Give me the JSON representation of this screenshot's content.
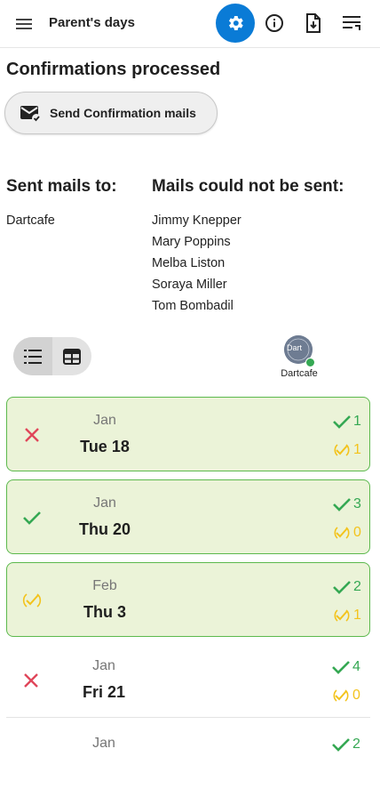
{
  "header": {
    "title": "Parent's days"
  },
  "main": {
    "section_title": "Confirmations processed",
    "send_button_label": "Send Confirmation mails",
    "sent_title": "Sent mails to:",
    "sent_list": [
      "Dartcafe"
    ],
    "failed_title": "Mails could not be sent:",
    "failed_list": [
      "Jimmy Knepper",
      "Mary Poppins",
      "Melba Liston",
      "Soraya Miller",
      "Tom Bombadil"
    ],
    "avatar_name": "Dartcafe",
    "avatar_initials": "Dart"
  },
  "dates": [
    {
      "month": "Jan",
      "date": "Tue 18",
      "status": "no",
      "yes": "1",
      "maybe": "1"
    },
    {
      "month": "Jan",
      "date": "Thu 20",
      "status": "yes",
      "yes": "3",
      "maybe": "0"
    },
    {
      "month": "Feb",
      "date": "Thu 3",
      "status": "maybe",
      "yes": "2",
      "maybe": "1"
    },
    {
      "month": "Jan",
      "date": "Fri 21",
      "status": "no",
      "yes": "4",
      "maybe": "0"
    },
    {
      "month": "Jan",
      "date": "",
      "status": "",
      "yes": "2",
      "maybe": ""
    }
  ],
  "colors": {
    "accent": "#0a7bd6",
    "confirmed_bg": "#ebf3d8",
    "confirmed_border": "#5cb94d",
    "yes": "#35a853",
    "maybe": "#f3c31c",
    "no": "#e0465a"
  }
}
